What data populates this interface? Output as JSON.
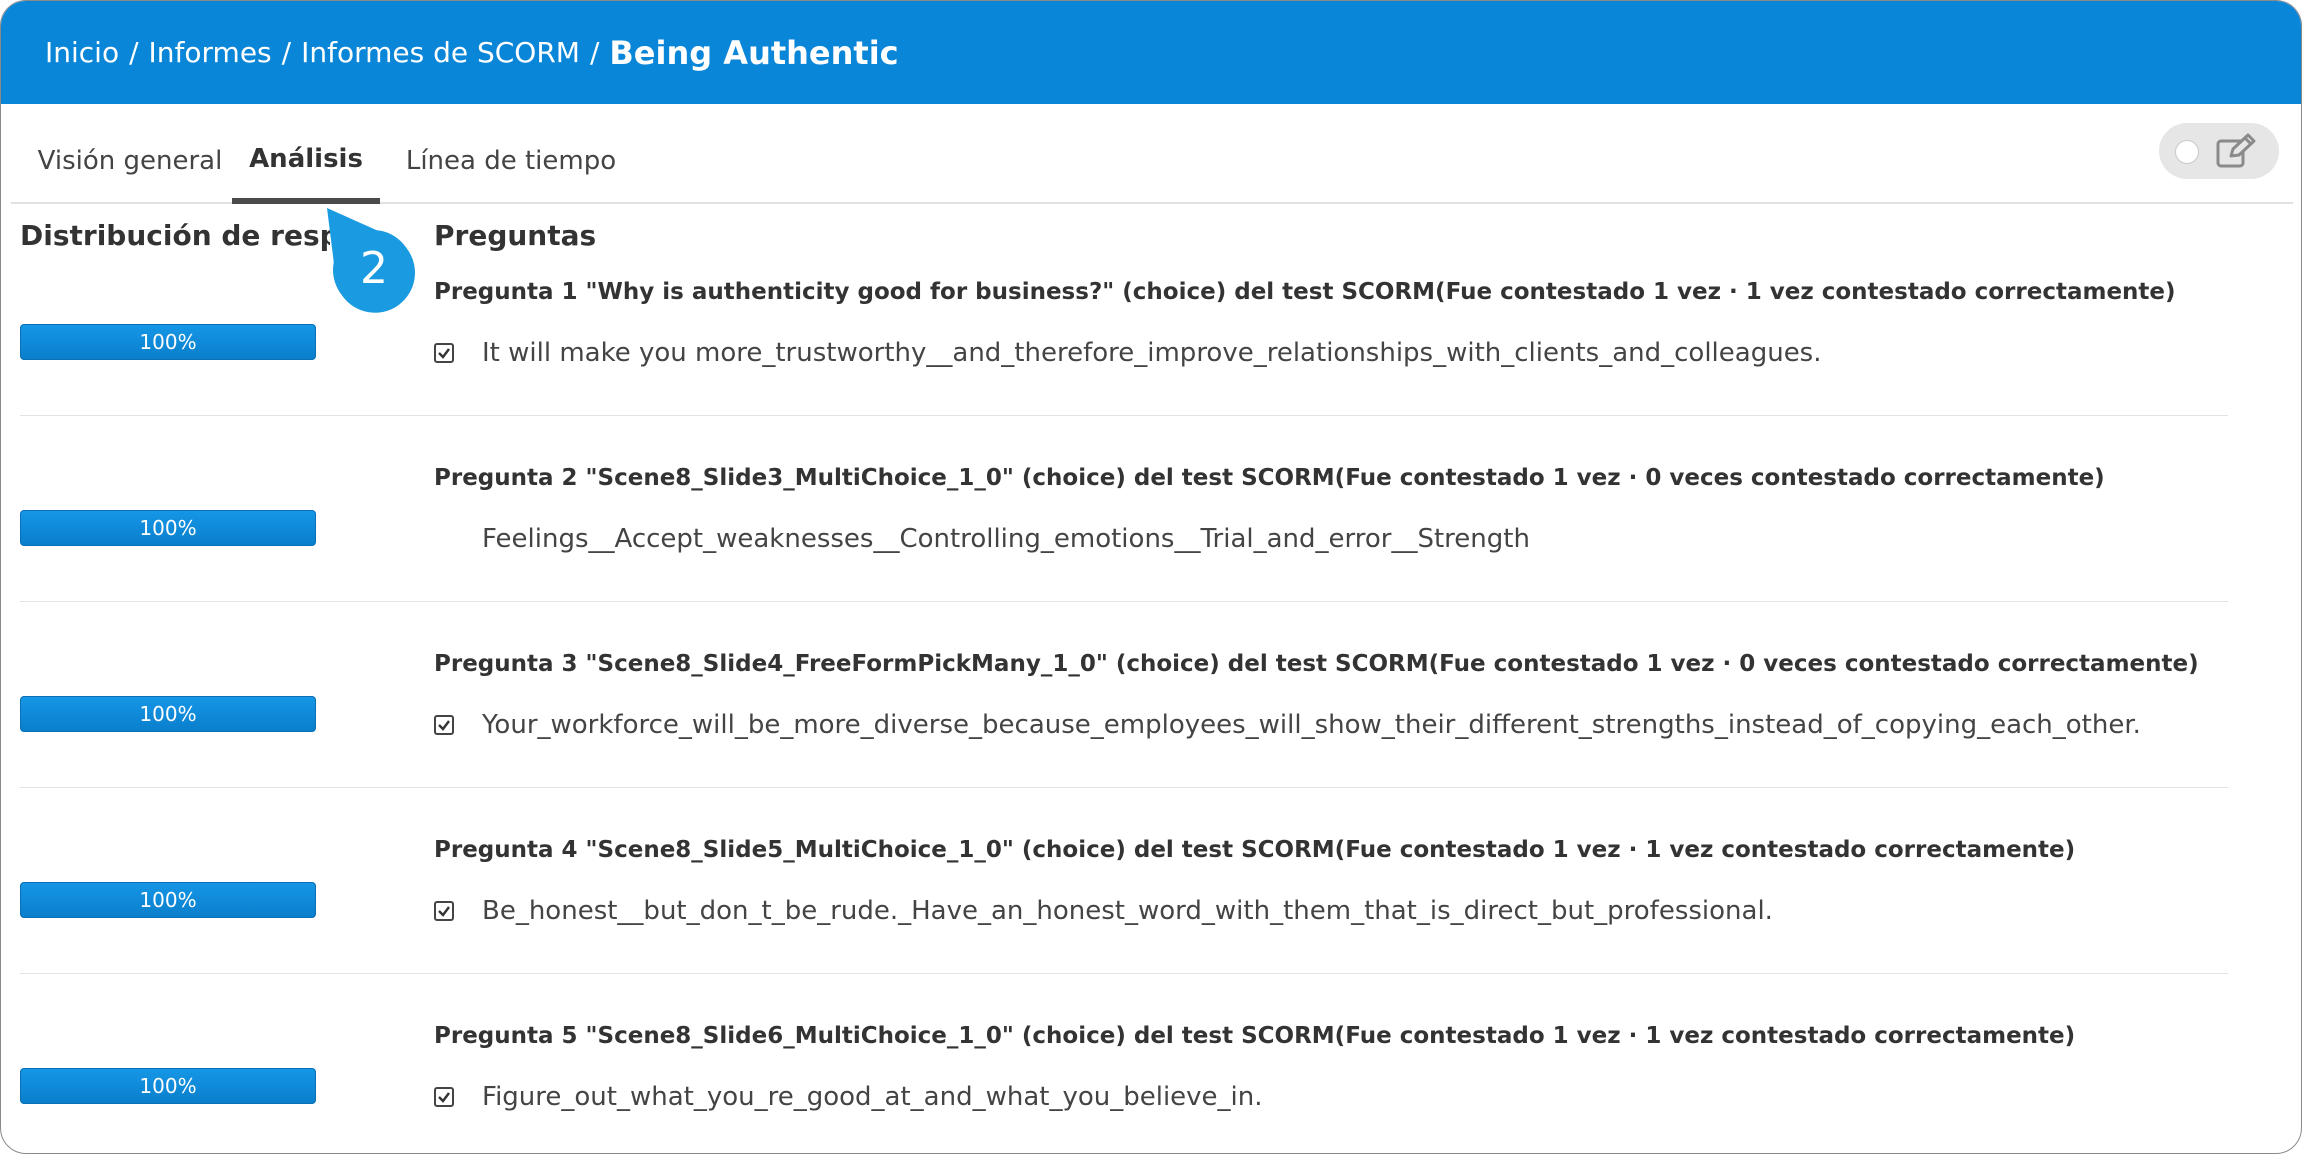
{
  "breadcrumb": {
    "items": [
      "Inicio",
      "Informes",
      "Informes de SCORM"
    ],
    "separator": "/",
    "current": "Being Authentic"
  },
  "tabs": [
    {
      "label": "Visión general",
      "active": false
    },
    {
      "label": "Análisis",
      "active": true
    },
    {
      "label": "Línea de tiempo",
      "active": false
    }
  ],
  "toggle": {
    "knob_icon": "toggle-knob-icon",
    "edit_icon": "edit-icon"
  },
  "callout": {
    "number": "2"
  },
  "left_panel": {
    "title": "Distribución de respuestas"
  },
  "right_panel": {
    "title": "Preguntas"
  },
  "questions": [
    {
      "title": "Pregunta 1  \"Why is authenticity good for business?\"  (choice) del test SCORM(Fue contestado 1 vez · 1 vez contestado correctamente)",
      "checked": true,
      "answer": "It will make you more_trustworthy__and_therefore_improve_relationships_with_clients_and_colleagues.",
      "percent_label": "100%",
      "percent": 100
    },
    {
      "title": "Pregunta 2  \"Scene8_Slide3_MultiChoice_1_0\"  (choice) del test SCORM(Fue contestado 1 vez · 0 veces contestado correctamente)",
      "checked": false,
      "answer": "Feelings__Accept_weaknesses__Controlling_emotions__Trial_and_error__Strength",
      "percent_label": "100%",
      "percent": 100
    },
    {
      "title": "Pregunta 3  \"Scene8_Slide4_FreeFormPickMany_1_0\"  (choice) del test SCORM(Fue contestado 1 vez · 0 veces contestado correctamente)",
      "checked": true,
      "answer": "Your_workforce_will_be_more_diverse_because_employees_will_show_their_different_strengths_instead_of_copying_each_other.",
      "percent_label": "100%",
      "percent": 100
    },
    {
      "title": "Pregunta 4  \"Scene8_Slide5_MultiChoice_1_0\"  (choice) del test SCORM(Fue contestado 1 vez · 1 vez contestado correctamente)",
      "checked": true,
      "answer": "Be_honest__but_don_t_be_rude._Have_an_honest_word_with_them_that_is_direct_but_professional.",
      "percent_label": "100%",
      "percent": 100
    },
    {
      "title": "Pregunta 5  \"Scene8_Slide6_MultiChoice_1_0\"  (choice) del test SCORM(Fue contestado 1 vez · 1 vez contestado correctamente)",
      "checked": true,
      "answer": "Figure_out_what_you_re_good_at_and_what_you_believe_in.",
      "percent_label": "100%",
      "percent": 100
    }
  ],
  "colors": {
    "header": "#0a86d8",
    "bar": "#0a86d8",
    "callout": "#1a9ae0"
  }
}
